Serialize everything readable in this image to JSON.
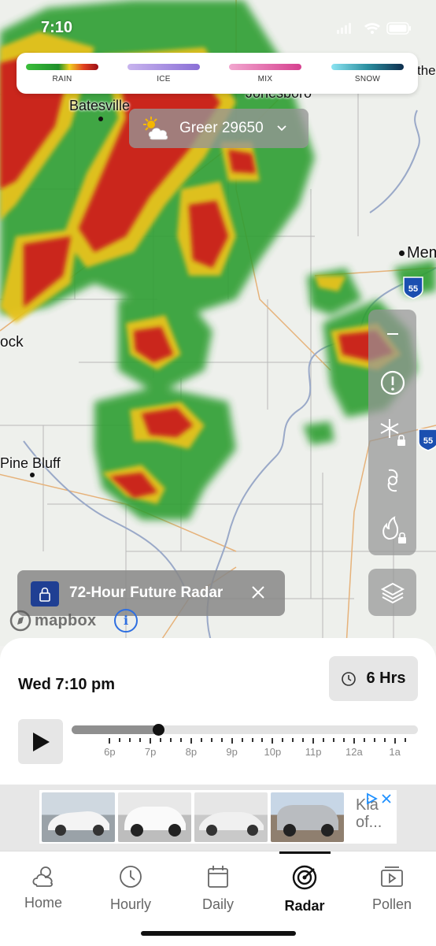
{
  "status_bar": {
    "time": "7:10"
  },
  "legend": {
    "items": [
      {
        "label": "RAIN"
      },
      {
        "label": "ICE"
      },
      {
        "label": "MIX"
      },
      {
        "label": "SNOW"
      }
    ]
  },
  "location": {
    "label": "Greer 29650"
  },
  "map": {
    "cities": [
      {
        "name": "Batesville"
      },
      {
        "name": "Jonesboro"
      },
      {
        "name": "Mem"
      },
      {
        "name": "ock"
      },
      {
        "name": "Pine Bluff"
      },
      {
        "name": "the"
      }
    ],
    "shields": [
      "55",
      "55"
    ],
    "attribution": "mapbox",
    "info_glyph": "i"
  },
  "side_controls": [
    "minus-icon",
    "alert-icon",
    "snow-lock-icon",
    "hurricane-icon",
    "fire-lock-icon"
  ],
  "future_radar": {
    "label": "72-Hour Future Radar"
  },
  "timeline": {
    "datetime": "Wed 7:10 pm",
    "duration": "6 Hrs",
    "progress": 0.25,
    "ticks": [
      "6p",
      "7p",
      "8p",
      "9p",
      "10p",
      "11p",
      "12a",
      "1a"
    ]
  },
  "ad": {
    "text_line1": "Kia",
    "text_line2": "of..."
  },
  "nav": {
    "items": [
      {
        "label": "Home"
      },
      {
        "label": "Hourly"
      },
      {
        "label": "Daily"
      },
      {
        "label": "Radar"
      },
      {
        "label": "Pollen"
      }
    ],
    "active": "Radar"
  },
  "colors": {
    "accent": "#1f3f93",
    "rain_heavy": "#c01010",
    "rain_light": "#2a9d2a"
  }
}
